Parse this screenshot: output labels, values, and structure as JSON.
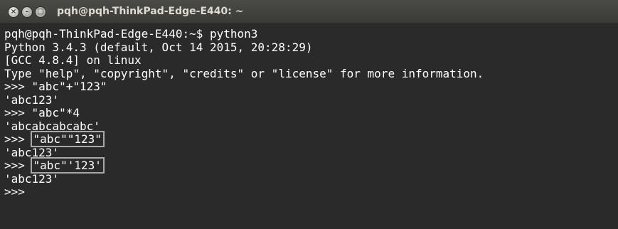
{
  "window": {
    "title": "pqh@pqh-ThinkPad-Edge-E440: ~",
    "buttons": {
      "close": "×",
      "minimize": "–",
      "maximize": "□"
    }
  },
  "terminal": {
    "lines": [
      {
        "text": "pqh@pqh-ThinkPad-Edge-E440:~$ python3"
      },
      {
        "text": "Python 3.4.3 (default, Oct 14 2015, 20:28:29)"
      },
      {
        "text": "[GCC 4.8.4] on linux"
      },
      {
        "text": "Type \"help\", \"copyright\", \"credits\" or \"license\" for more information."
      },
      {
        "text": ">>> \"abc\"+\"123\""
      },
      {
        "text": "'abc123'"
      },
      {
        "text": ">>> \"abc\"*4"
      },
      {
        "text": "'abcabcabcabc'"
      },
      {
        "prompt": ">>> ",
        "boxed": "\"abc\"\"123\""
      },
      {
        "text": "'abc123'"
      },
      {
        "prompt": ">>> ",
        "boxed": "\"abc\"'123'"
      },
      {
        "text": "'abc123'"
      },
      {
        "text": ">>> "
      }
    ]
  }
}
